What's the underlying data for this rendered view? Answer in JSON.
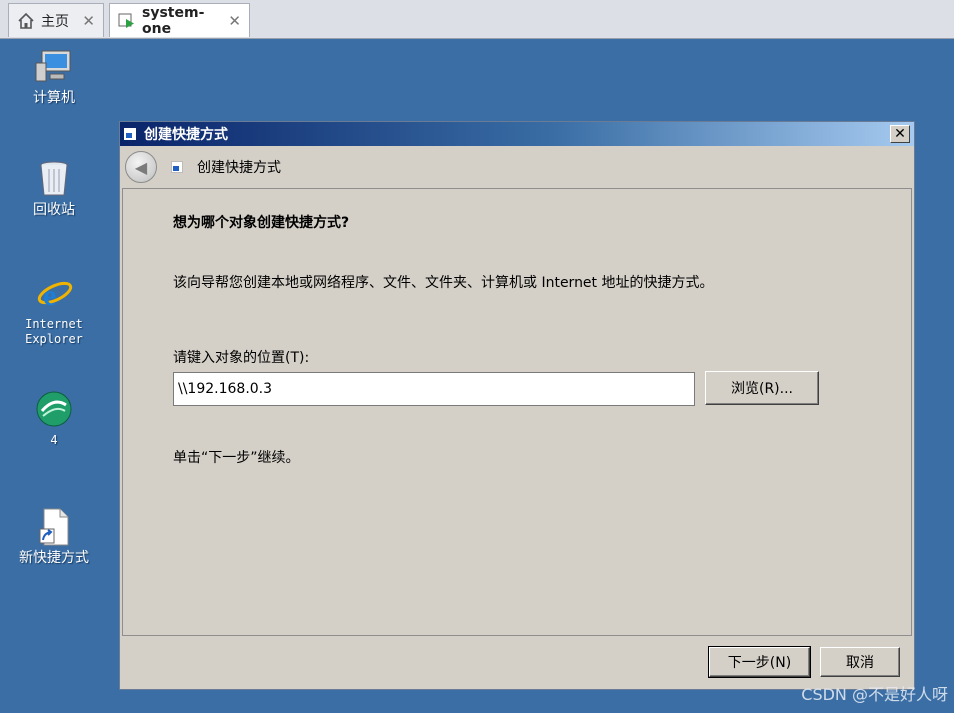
{
  "tabs": [
    {
      "label": "主页",
      "icon": "home-icon"
    },
    {
      "label": "system-one",
      "icon": "vm-running-icon"
    }
  ],
  "desktop": {
    "icons": [
      {
        "label": "计算机",
        "icon": "computer-icon"
      },
      {
        "label": "回收站",
        "icon": "recycle-bin-icon"
      },
      {
        "label": "Internet\nExplorer",
        "icon": "internet-explorer-icon"
      },
      {
        "label": "4",
        "icon": "app-4-icon"
      },
      {
        "label": "新快捷方式",
        "icon": "shortcut-file-icon"
      }
    ]
  },
  "dialog": {
    "title": "创建快捷方式",
    "header_title": "创建快捷方式",
    "question": "想为哪个对象创建快捷方式?",
    "description": "该向导帮您创建本地或网络程序、文件、文件夹、计算机或 Internet 地址的快捷方式。",
    "location_label": "请键入对象的位置(T):",
    "location_value": "\\\\192.168.0.3",
    "browse_label": "浏览(R)...",
    "hint": "单击“下一步”继续。",
    "next_label": "下一步(N)",
    "cancel_label": "取消"
  },
  "watermark": "CSDN @不是好人呀",
  "colors": {
    "desktop": "#3a6ea5",
    "dialog_face": "#d4d0c8",
    "titlebar_start": "#0a246a",
    "titlebar_end": "#a6caf0"
  }
}
